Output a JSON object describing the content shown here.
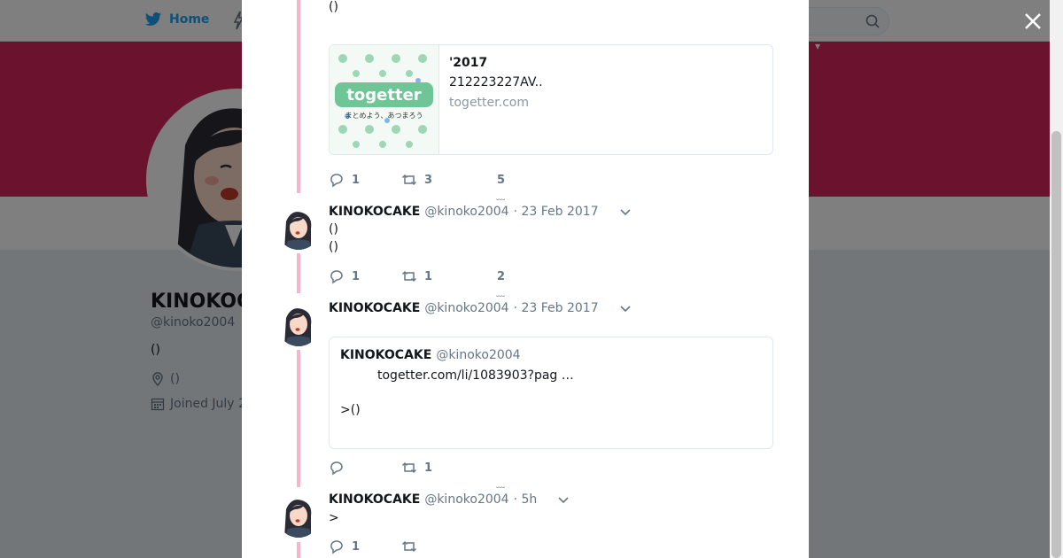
{
  "nav": {
    "home_label": "Home",
    "lang_caret": "▾"
  },
  "profile": {
    "name": "KINOKOCAKE",
    "handle": "@kinoko2004",
    "bio": "()",
    "location": "()",
    "joined": "Joined July 2"
  },
  "tweets": [
    {
      "text": "()",
      "card": {
        "title": "'2017",
        "description": "212223227AV..",
        "domain": "togetter.com",
        "thumb_brand": "togetter",
        "thumb_tagline": "まとめよう、あつまろう"
      },
      "replies": "1",
      "retweets": "3",
      "likes": "5"
    },
    {
      "name": "KINOKOCAKE",
      "handle": "@kinoko2004",
      "date": "· 23 Feb 2017",
      "lines": [
        "()",
        "()"
      ],
      "replies": "1",
      "retweets": "1",
      "likes": "2"
    },
    {
      "name": "KINOKOCAKE",
      "handle": "@kinoko2004",
      "date": "· 23 Feb 2017",
      "quote": {
        "name": "KINOKOCAKE",
        "handle": "@kinoko2004",
        "line1": "togetter.com/li/1083903?pag  …",
        "line2": ">()"
      },
      "replies": "",
      "retweets": "1",
      "likes": ""
    },
    {
      "name": "KINOKOCAKE",
      "handle": "@kinoko2004",
      "date": "· 5h",
      "text": ">",
      "replies": "1",
      "retweets": "",
      "likes": ""
    }
  ],
  "colors": {
    "accent": "#1da1f2",
    "banner": "#d6255f",
    "thread": "#f4b6c8"
  },
  "icons": [
    "twitter-bird-icon",
    "search-icon",
    "close-icon",
    "reply-icon",
    "retweet-icon",
    "chevron-down-icon",
    "location-icon",
    "calendar-icon"
  ]
}
